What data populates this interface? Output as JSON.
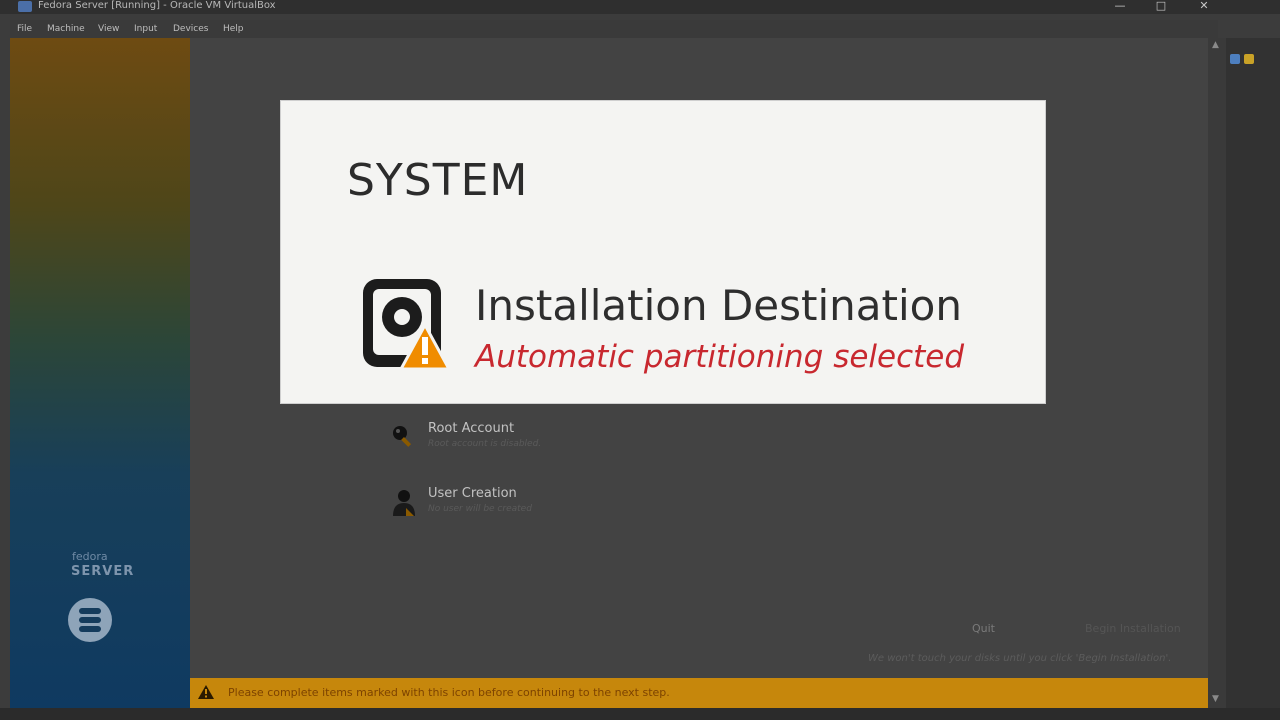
{
  "window": {
    "title": "Fedora Server [Running] - Oracle VM VirtualBox",
    "minimize_glyph": "—",
    "maximize_glyph": "□",
    "close_glyph": "✕"
  },
  "menu": {
    "items": [
      "File",
      "Machine",
      "View",
      "Input",
      "Devices",
      "Help"
    ]
  },
  "sidebar": {
    "brand_small": "fedora",
    "brand_product": "SERVER"
  },
  "hub": {
    "spokes": [
      {
        "title": "Root Account",
        "status": "Root account is disabled.",
        "icon": "key-icon"
      },
      {
        "title": "User Creation",
        "status": "No user will be created",
        "icon": "user-icon"
      }
    ],
    "quit_label": "Quit",
    "begin_label": "Begin Installation",
    "footer_note": "We won't touch your disks until you click 'Begin Installation'."
  },
  "warning": {
    "text": "Please complete items marked with this icon before continuing to the next step.",
    "icon": "warning-icon",
    "color": "#c6870c"
  },
  "zoom": {
    "section_title": "SYSTEM",
    "spoke_title": "Installation Destination",
    "spoke_status": "Automatic partitioning selected",
    "status_color": "#c8282f",
    "icon": "disk-warning-icon"
  }
}
